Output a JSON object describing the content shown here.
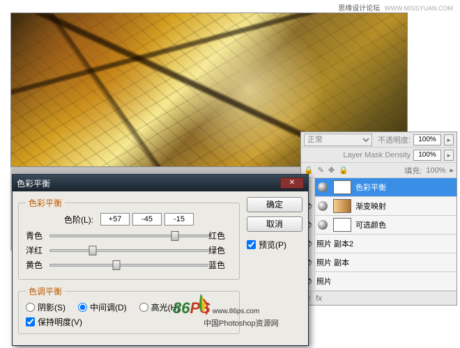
{
  "watermark_top": {
    "main": "思缘设计论坛",
    "sub": "WWW.MISSYUAN.COM"
  },
  "layers_panel": {
    "blend_mode": "正常",
    "opacity_label": "不透明度:",
    "opacity_value": "100%",
    "mask_label": "Layer Mask Density",
    "mask_value": "100%",
    "fill_label": "填充:",
    "fill_value": "100%",
    "layers": [
      {
        "name": "色彩平衡",
        "has_ball": true,
        "has_thumb": true,
        "thumb": "white",
        "selected": true
      },
      {
        "name": "渐变映射",
        "has_ball": true,
        "has_thumb": true,
        "thumb": "grad",
        "selected": false
      },
      {
        "name": "可选颜色",
        "has_ball": true,
        "has_thumb": true,
        "thumb": "white",
        "selected": false
      },
      {
        "name": "照片 副本2",
        "has_ball": false,
        "has_thumb": false,
        "selected": false
      },
      {
        "name": "照片 副本",
        "has_ball": false,
        "has_thumb": false,
        "selected": false
      },
      {
        "name": "照片",
        "has_ball": false,
        "has_thumb": false,
        "selected": false
      }
    ]
  },
  "dialog": {
    "title": "色彩平衡",
    "ok": "确定",
    "cancel": "取消",
    "preview": "预览(P)",
    "section1_title": "色彩平衡",
    "levels_label": "色阶(L):",
    "levels": [
      "+57",
      "-45",
      "-15"
    ],
    "sliders": [
      {
        "left": "青色",
        "right": "红色",
        "pos": 79
      },
      {
        "left": "洋红",
        "right": "绿色",
        "pos": 27
      },
      {
        "left": "黄色",
        "right": "蓝色",
        "pos": 42
      }
    ],
    "section2_title": "色调平衡",
    "radios": {
      "shadows": "阴影(S)",
      "midtones": "中间调(D)",
      "highlights": "高光(H)",
      "selected": "midtones"
    },
    "preserve": "保持明度(V)"
  },
  "logo": {
    "text": "86",
    "suffix": "PS",
    "url": "www.86ps.com",
    "cn": "中国Photoshop资源网"
  }
}
